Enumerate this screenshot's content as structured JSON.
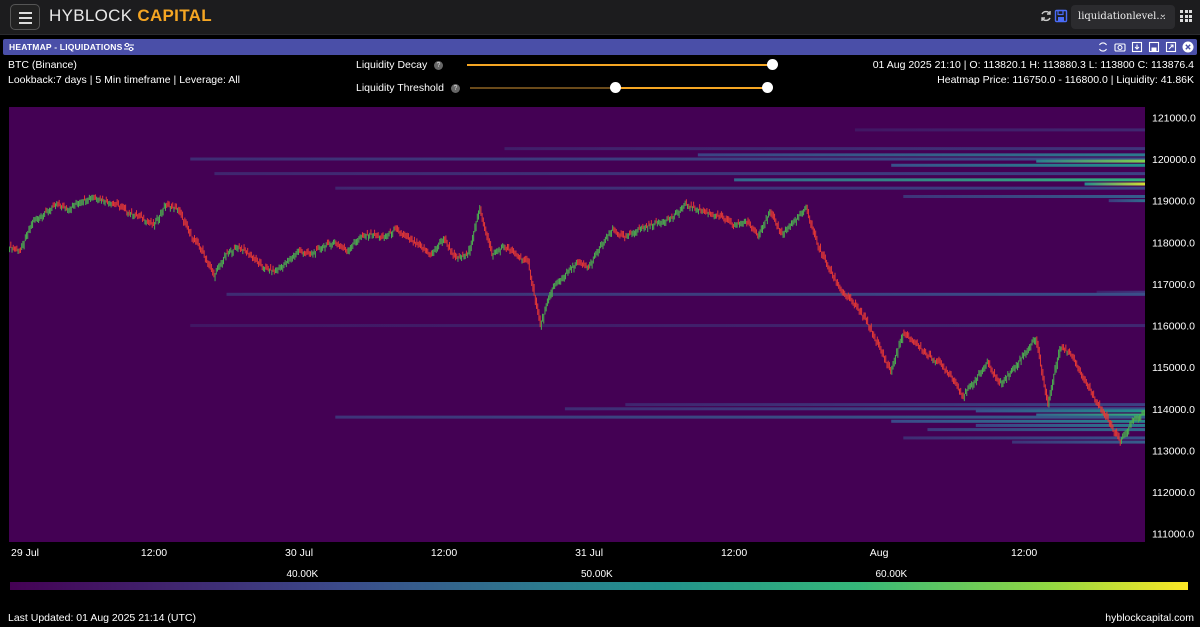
{
  "app": {
    "logo_part1": "HYBLOCK",
    "logo_part2": "CAPITAL",
    "selector_value": "liquidationlevel...",
    "colors": {
      "brand": "#f5a623",
      "panel_header": "#4a4fa8",
      "background": "#000000",
      "heat_base": "#440154"
    }
  },
  "panel": {
    "title": "HEATMAP - LIQUIDATIONS",
    "icons": [
      "refresh-icon",
      "camera-icon",
      "download-icon",
      "save-icon",
      "expand-icon",
      "close-icon"
    ]
  },
  "info": {
    "symbol": "BTC (Binance)",
    "params": "Lookback:7 days | 5 Min timeframe | Leverage: All",
    "ohlc": "01 Aug 2025 21:10 | O: 113820.1 H: 113880.3 L: 113800 C: 113876.4",
    "heatmap_price": "Heatmap Price: 116750.0 - 116800.0 | Liquidity: 41.86K"
  },
  "controls": {
    "decay_label": "Liquidity Decay",
    "threshold_label": "Liquidity Threshold",
    "decay_value": 1.0,
    "threshold_range": [
      0.48,
      1.0
    ]
  },
  "chart_data": {
    "type": "heatmap",
    "title": "HEATMAP - LIQUIDATIONS",
    "x_ticks": [
      "29 Jul",
      "12:00",
      "30 Jul",
      "12:00",
      "31 Jul",
      "12:00",
      "Aug",
      "12:00"
    ],
    "x_tick_hours": [
      0,
      12,
      24,
      36,
      48,
      60,
      72,
      84
    ],
    "x_range_hours": [
      0,
      94
    ],
    "y_ticks": [
      "121000.0",
      "120000.0",
      "119000.0",
      "118000.0",
      "117000.0",
      "116000.0",
      "115000.0",
      "114000.0",
      "113000.0",
      "112000.0",
      "111000.0"
    ],
    "ylim": [
      110800,
      121250
    ],
    "colorbar": {
      "ticks": [
        "40.00K",
        "50.00K",
        "60.00K"
      ],
      "tick_values": [
        40000,
        50000,
        60000
      ],
      "range": [
        30000,
        70000
      ]
    },
    "price_series": [
      [
        0,
        117900
      ],
      [
        1,
        117800
      ],
      [
        2,
        118500
      ],
      [
        3,
        118700
      ],
      [
        4,
        118900
      ],
      [
        5,
        118800
      ],
      [
        6,
        119000
      ],
      [
        7,
        119100
      ],
      [
        8,
        119000
      ],
      [
        9,
        118900
      ],
      [
        10,
        118700
      ],
      [
        11,
        118600
      ],
      [
        12,
        118400
      ],
      [
        13,
        118900
      ],
      [
        14,
        118800
      ],
      [
        15,
        118200
      ],
      [
        16,
        117800
      ],
      [
        17,
        117200
      ],
      [
        18,
        117700
      ],
      [
        19,
        117900
      ],
      [
        20,
        117700
      ],
      [
        21,
        117400
      ],
      [
        22,
        117300
      ],
      [
        23,
        117500
      ],
      [
        24,
        117800
      ],
      [
        25,
        117700
      ],
      [
        26,
        117900
      ],
      [
        27,
        118000
      ],
      [
        28,
        117800
      ],
      [
        29,
        118100
      ],
      [
        30,
        118200
      ],
      [
        31,
        118100
      ],
      [
        32,
        118300
      ],
      [
        33,
        118100
      ],
      [
        34,
        117900
      ],
      [
        35,
        117700
      ],
      [
        36,
        118100
      ],
      [
        37,
        117600
      ],
      [
        38,
        117700
      ],
      [
        39,
        118800
      ],
      [
        40,
        117700
      ],
      [
        41,
        117900
      ],
      [
        42,
        117700
      ],
      [
        43,
        117500
      ],
      [
        44,
        116000
      ],
      [
        45,
        116900
      ],
      [
        46,
        117200
      ],
      [
        47,
        117500
      ],
      [
        48,
        117400
      ],
      [
        49,
        117900
      ],
      [
        50,
        118300
      ],
      [
        51,
        118100
      ],
      [
        52,
        118300
      ],
      [
        53,
        118400
      ],
      [
        54,
        118500
      ],
      [
        55,
        118600
      ],
      [
        56,
        118900
      ],
      [
        57,
        118800
      ],
      [
        58,
        118700
      ],
      [
        59,
        118600
      ],
      [
        60,
        118400
      ],
      [
        61,
        118500
      ],
      [
        62,
        118200
      ],
      [
        63,
        118700
      ],
      [
        64,
        118200
      ],
      [
        65,
        118500
      ],
      [
        66,
        118800
      ],
      [
        67,
        117900
      ],
      [
        68,
        117300
      ],
      [
        69,
        116800
      ],
      [
        70,
        116500
      ],
      [
        71,
        116100
      ],
      [
        72,
        115500
      ],
      [
        73,
        114900
      ],
      [
        74,
        115800
      ],
      [
        75,
        115600
      ],
      [
        76,
        115300
      ],
      [
        77,
        115100
      ],
      [
        78,
        114800
      ],
      [
        79,
        114300
      ],
      [
        80,
        114700
      ],
      [
        81,
        115100
      ],
      [
        82,
        114600
      ],
      [
        83,
        114900
      ],
      [
        84,
        115300
      ],
      [
        85,
        115700
      ],
      [
        86,
        114100
      ],
      [
        87,
        115500
      ],
      [
        88,
        115300
      ],
      [
        89,
        114700
      ],
      [
        90,
        114200
      ],
      [
        91,
        113700
      ],
      [
        92,
        113200
      ],
      [
        93,
        113700
      ],
      [
        94,
        113900
      ]
    ],
    "liquidity_bands": [
      {
        "price": 120700,
        "x_start": 70,
        "value": 36000
      },
      {
        "price": 120250,
        "x_start": 41,
        "value": 38000
      },
      {
        "price": 120100,
        "x_start": 57,
        "value": 48000
      },
      {
        "price": 120000,
        "x_start": 15,
        "value": 42000
      },
      {
        "price": 119950,
        "x_start": 85,
        "value": 64000
      },
      {
        "price": 119850,
        "x_start": 73,
        "value": 52000
      },
      {
        "price": 119650,
        "x_start": 17,
        "value": 40000
      },
      {
        "price": 119500,
        "x_start": 60,
        "value": 58000
      },
      {
        "price": 119400,
        "x_start": 89,
        "value": 68000
      },
      {
        "price": 119300,
        "x_start": 27,
        "value": 40000
      },
      {
        "price": 119100,
        "x_start": 74,
        "value": 44000
      },
      {
        "price": 119000,
        "x_start": 91,
        "value": 46000
      },
      {
        "price": 116800,
        "x_start": 90,
        "value": 38000
      },
      {
        "price": 116750,
        "x_start": 18,
        "value": 41860
      },
      {
        "price": 116000,
        "x_start": 15,
        "value": 36000
      },
      {
        "price": 114100,
        "x_start": 51,
        "value": 40000
      },
      {
        "price": 114000,
        "x_start": 46,
        "value": 42000
      },
      {
        "price": 113950,
        "x_start": 80,
        "value": 52000
      },
      {
        "price": 113850,
        "x_start": 85,
        "value": 58000
      },
      {
        "price": 113800,
        "x_start": 27,
        "value": 44000
      },
      {
        "price": 113700,
        "x_start": 73,
        "value": 50000
      },
      {
        "price": 113600,
        "x_start": 80,
        "value": 48000
      },
      {
        "price": 113500,
        "x_start": 76,
        "value": 46000
      },
      {
        "price": 113300,
        "x_start": 74,
        "value": 42000
      },
      {
        "price": 113200,
        "x_start": 83,
        "value": 44000
      }
    ]
  },
  "footer": {
    "last_updated": "Last Updated: 01 Aug 2025 21:14 (UTC)",
    "site": "hyblockcapital.com"
  }
}
